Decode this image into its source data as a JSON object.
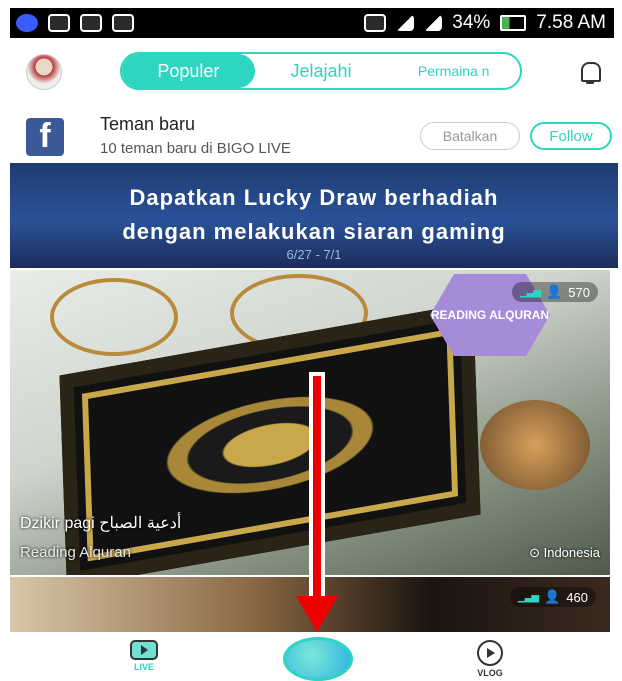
{
  "statusbar": {
    "battery": "34%",
    "time": "7.58 AM"
  },
  "tabs": [
    {
      "label": "Populer"
    },
    {
      "label": "Jelajahi"
    },
    {
      "label": "Permaina n"
    }
  ],
  "friend_suggestion": {
    "title": "Teman baru",
    "subtitle": "10 teman baru di BIGO LIVE",
    "cancel_label": "Batalkan",
    "follow_label": "Follow"
  },
  "banner": {
    "line1": "Dapatkan Lucky Draw berhadiah",
    "line2": "dengan melakukan siaran gaming",
    "date": "6/27 - 7/1"
  },
  "live_cards": [
    {
      "viewers": "570",
      "tile_text": "READING ALQURAN",
      "title": "Dzikir pagi أدعية الصباح",
      "tag": "Reading Alquran",
      "location": "Indonesia"
    },
    {
      "viewers": "460"
    }
  ],
  "bottom_nav": {
    "live_label": "LIVE",
    "vlog_label": "VLOG"
  },
  "colors": {
    "accent": "#2ed5c0",
    "arrow": "#e00000"
  }
}
